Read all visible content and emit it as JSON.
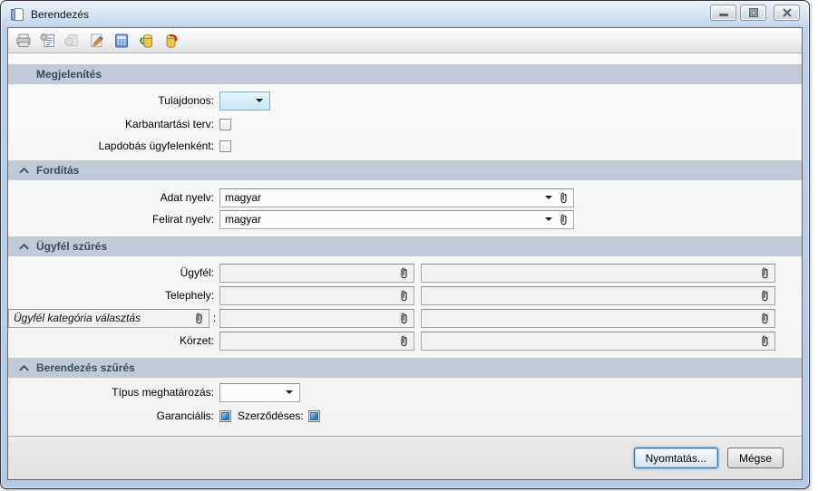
{
  "window": {
    "title": "Berendezés"
  },
  "titlebar": {
    "controls": [
      "minimize-icon",
      "maximize-icon",
      "close-icon"
    ]
  },
  "toolbar": {
    "icons": [
      "print-icon",
      "print-preview-icon",
      "print-disabled-icon",
      "edit-icon",
      "calculator-icon",
      "database-export-icon",
      "database-import-icon"
    ]
  },
  "sections": {
    "megjelenites": {
      "title": "Megjelenítés",
      "tulajdonos_label": "Tulajdonos:",
      "tulajdonos_value": "",
      "karbantartasi_label": "Karbantartási terv:",
      "karbantartasi_state": "unchecked",
      "lapdobas_label": "Lapdobás ügyfelenként:",
      "lapdobas_state": "unchecked"
    },
    "forditas": {
      "title": "Fordítás",
      "adat_label": "Adat nyelv:",
      "adat_value": "magyar",
      "felirat_label": "Felirat nyelv:",
      "felirat_value": "magyar"
    },
    "ugyfel_szures": {
      "title": "Ügyfél szűrés",
      "ugyfel_label": "Ügyfél:",
      "ugyfel_value1": "",
      "ugyfel_value2": "",
      "telephely_label": "Telephely:",
      "telephely_value1": "",
      "telephely_value2": "",
      "kategoria_selector_text": "Ügyfél kategória választás",
      "kategoria_separator": ":",
      "kategoria_value1": "",
      "kategoria_value2": "",
      "korzet_label": "Körzet:",
      "korzet_value1": "",
      "korzet_value2": ""
    },
    "berendezes_szures": {
      "title": "Berendezés szűrés",
      "tipus_label": "Típus meghatározás:",
      "tipus_value": "",
      "garancialis_label": "Garanciális:",
      "garancialis_state": "indeterminate",
      "szerzodeses_label": "Szerződéses:",
      "szerzodeses_state": "indeterminate"
    }
  },
  "footer": {
    "print_button": "Nyomtatás...",
    "cancel_button": "Mégse"
  },
  "colors": {
    "section_header_bg": "#bfccd8",
    "section_header_text": "#394b5c",
    "titlebar_top": "#eaf3fc",
    "frame_blue": "#b4cbe8",
    "owner_combo_bg": "#cfe8f8",
    "owner_combo_border": "#7fb1d5",
    "checkbox_indeterminate_blue": "#2f7cb5",
    "default_button_border": "#2e6da4",
    "form_bg": "#f7f5f4"
  }
}
